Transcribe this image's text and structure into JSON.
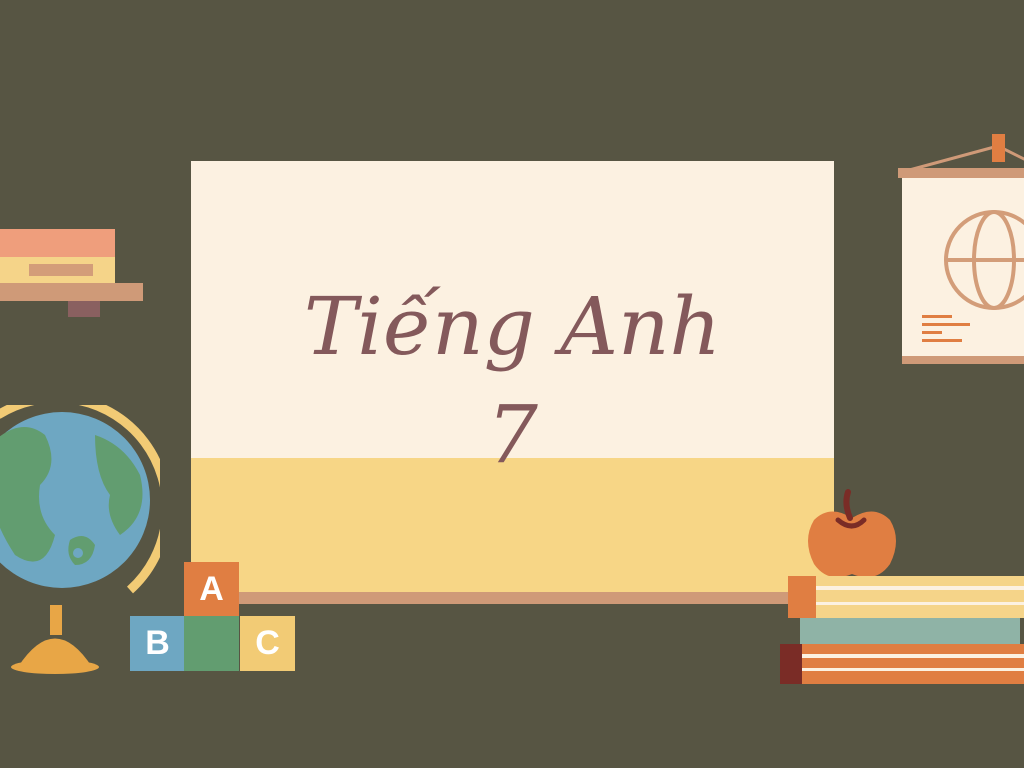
{
  "slide": {
    "title": "Tiếng Anh",
    "grade": "7"
  },
  "blocks": {
    "a": "A",
    "b": "B",
    "c": "C"
  },
  "colors": {
    "background": "#575543",
    "board": "#fcf1e1",
    "board_lower": "#f7d686",
    "title_text": "#84595b"
  },
  "decorations": [
    "shelf-with-books",
    "globe-icon",
    "abc-blocks",
    "wall-map-scroll",
    "apple-icon",
    "book-stack"
  ]
}
